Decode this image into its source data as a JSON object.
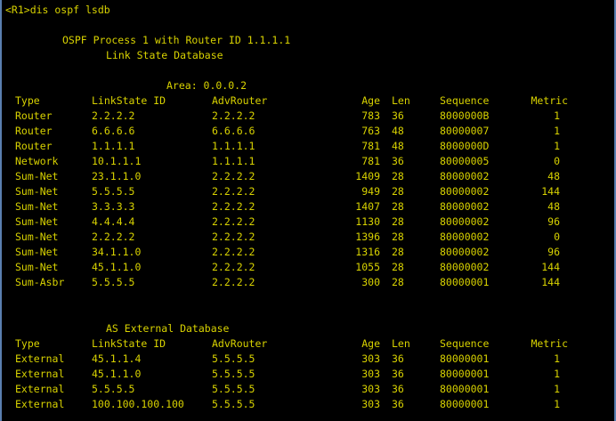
{
  "prompt": "<R1>dis ospf lsdb",
  "header": {
    "process_line": "OSPF Process 1 with Router ID 1.1.1.1",
    "db_title": "Link State Database"
  },
  "area_line": "Area: 0.0.0.2",
  "lsdb_headers": [
    "Type",
    "LinkState ID",
    "AdvRouter",
    "Age",
    "Len",
    "Sequence",
    "Metric"
  ],
  "lsdb_rows": [
    [
      "Router",
      "2.2.2.2",
      "2.2.2.2",
      "783",
      "36",
      "8000000B",
      "1"
    ],
    [
      "Router",
      "6.6.6.6",
      "6.6.6.6",
      "763",
      "48",
      "80000007",
      "1"
    ],
    [
      "Router",
      "1.1.1.1",
      "1.1.1.1",
      "781",
      "48",
      "8000000D",
      "1"
    ],
    [
      "Network",
      "10.1.1.1",
      "1.1.1.1",
      "781",
      "36",
      "80000005",
      "0"
    ],
    [
      "Sum-Net",
      "23.1.1.0",
      "2.2.2.2",
      "1409",
      "28",
      "80000002",
      "48"
    ],
    [
      "Sum-Net",
      "5.5.5.5",
      "2.2.2.2",
      "949",
      "28",
      "80000002",
      "144"
    ],
    [
      "Sum-Net",
      "3.3.3.3",
      "2.2.2.2",
      "1407",
      "28",
      "80000002",
      "48"
    ],
    [
      "Sum-Net",
      "4.4.4.4",
      "2.2.2.2",
      "1130",
      "28",
      "80000002",
      "96"
    ],
    [
      "Sum-Net",
      "2.2.2.2",
      "2.2.2.2",
      "1396",
      "28",
      "80000002",
      "0"
    ],
    [
      "Sum-Net",
      "34.1.1.0",
      "2.2.2.2",
      "1316",
      "28",
      "80000002",
      "96"
    ],
    [
      "Sum-Net",
      "45.1.1.0",
      "2.2.2.2",
      "1055",
      "28",
      "80000002",
      "144"
    ],
    [
      "Sum-Asbr",
      "5.5.5.5",
      "2.2.2.2",
      "300",
      "28",
      "80000001",
      "144"
    ]
  ],
  "ext_title": "AS External Database",
  "ext_headers": [
    "Type",
    "LinkState ID",
    "AdvRouter",
    "Age",
    "Len",
    "Sequence",
    "Metric"
  ],
  "ext_rows": [
    [
      "External",
      "45.1.1.4",
      "5.5.5.5",
      "303",
      "36",
      "80000001",
      "1"
    ],
    [
      "External",
      "45.1.1.0",
      "5.5.5.5",
      "303",
      "36",
      "80000001",
      "1"
    ],
    [
      "External",
      "5.5.5.5",
      "5.5.5.5",
      "303",
      "36",
      "80000001",
      "1"
    ],
    [
      "External",
      "100.100.100.100",
      "5.5.5.5",
      "303",
      "36",
      "80000001",
      "1"
    ]
  ],
  "colors": {
    "background": "#000000",
    "text": "#d8d200",
    "window_edge": "#5a7fb0"
  }
}
